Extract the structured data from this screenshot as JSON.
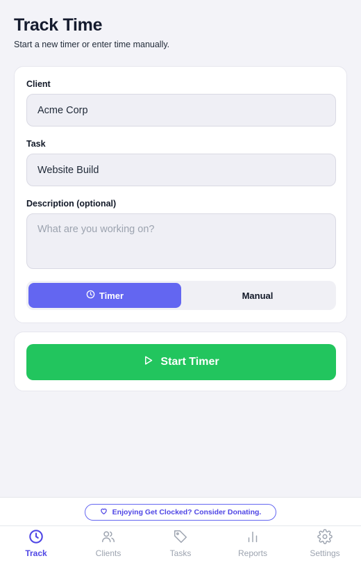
{
  "header": {
    "title": "Track Time",
    "subtitle": "Start a new timer or enter time manually."
  },
  "form": {
    "client_label": "Client",
    "client_value": "Acme Corp",
    "task_label": "Task",
    "task_value": "Website Build",
    "description_label": "Description (optional)",
    "description_placeholder": "What are you working on?",
    "mode_toggle": {
      "options": [
        "Timer",
        "Manual"
      ],
      "selected": "Timer"
    }
  },
  "action": {
    "start_label": "Start Timer"
  },
  "donate": {
    "label": "Enjoying Get Clocked? Consider Donating."
  },
  "tabs": [
    {
      "label": "Track",
      "icon": "clock-icon",
      "active": true
    },
    {
      "label": "Clients",
      "icon": "users-icon",
      "active": false
    },
    {
      "label": "Tasks",
      "icon": "tag-icon",
      "active": false
    },
    {
      "label": "Reports",
      "icon": "bar-chart-icon",
      "active": false
    },
    {
      "label": "Settings",
      "icon": "gear-icon",
      "active": false
    }
  ],
  "colors": {
    "accent": "#6366f1",
    "success": "#22c55e",
    "background": "#f3f3f8"
  }
}
